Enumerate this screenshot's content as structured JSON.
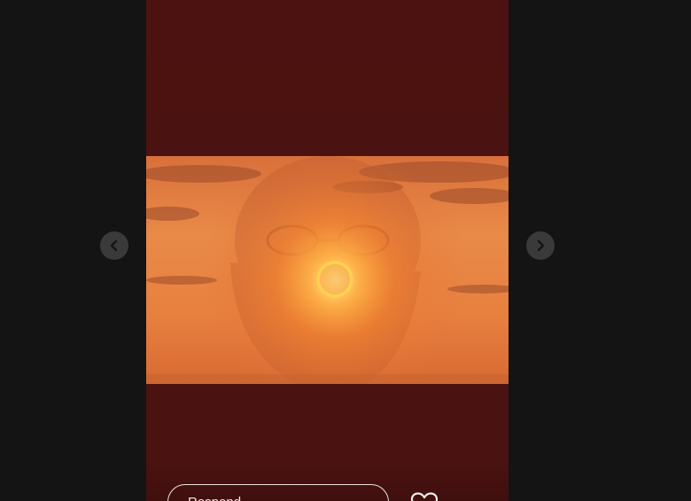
{
  "story_viewer": {
    "prev_icon": "chevron-left-icon",
    "next_icon": "chevron-right-icon",
    "like_icon": "heart-icon",
    "reply": {
      "value": "",
      "placeholder": "Respond..."
    },
    "colors": {
      "page_background": "#141414",
      "story_background": "#4a1210",
      "nav_button": "#3a3a3a",
      "ring_accent": "#ffd34a"
    }
  }
}
